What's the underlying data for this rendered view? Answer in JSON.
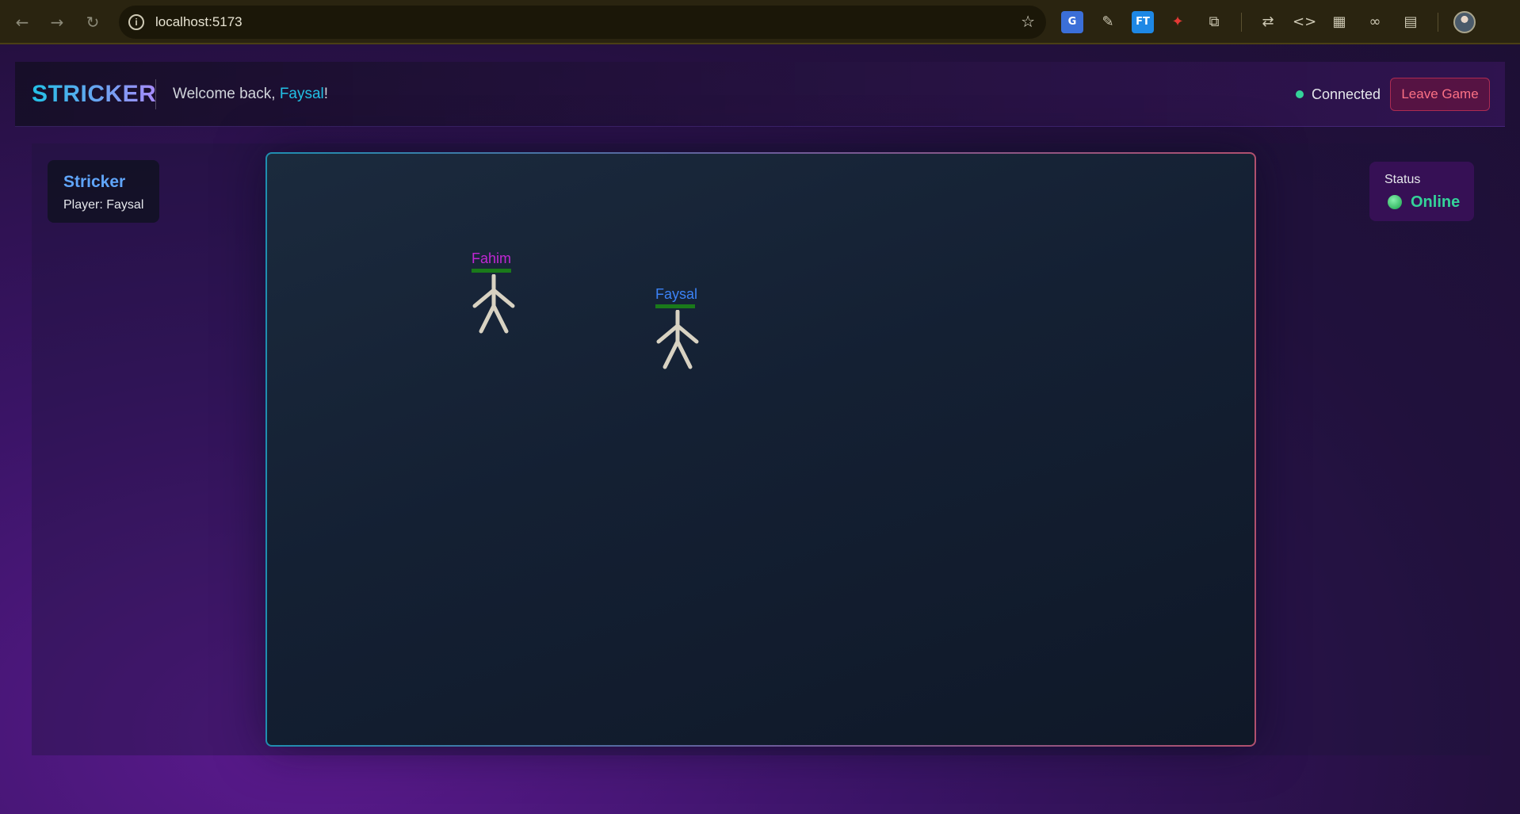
{
  "browser": {
    "url": "localhost:5173",
    "back_icon": "arrow-left-icon",
    "forward_icon": "arrow-right-icon",
    "reload_icon": "reload-icon",
    "extensions": [
      "google-translate-icon",
      "eyedropper-icon",
      "ft-extension-icon",
      "ninja-extension-icon",
      "puzzle-icon",
      "translate-page-icon",
      "code-icon",
      "layout-icon",
      "link-icon",
      "reading-mode-icon"
    ]
  },
  "header": {
    "logo": "STRICKER",
    "welcome_prefix": "Welcome back, ",
    "username": "Faysal",
    "welcome_suffix": "!",
    "connection_status": "Connected",
    "leave_button": "Leave Game"
  },
  "info_card": {
    "title": "Stricker",
    "player_label": "Player: Faysal"
  },
  "status_card": {
    "label": "Status",
    "value": "Online"
  },
  "players": [
    {
      "name": "Fahim",
      "color": "#c026d3",
      "health": 1.0
    },
    {
      "name": "Faysal",
      "color": "#3b82f6",
      "health": 1.0
    }
  ],
  "colors": {
    "accent_cyan": "#22c1e6",
    "accent_violet": "#a78bfa",
    "connected_green": "#34d399",
    "leave_red": "#fb7185",
    "health_green": "#1a7a1a"
  }
}
